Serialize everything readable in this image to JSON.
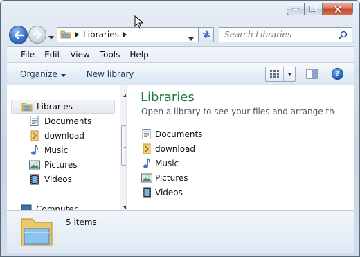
{
  "window": {
    "caption_buttons": [
      "minimize",
      "maximize",
      "close"
    ]
  },
  "navigation": {
    "address_crumbs": [
      "Libraries"
    ],
    "search_placeholder": "Search Libraries"
  },
  "menu": {
    "items": [
      "File",
      "Edit",
      "View",
      "Tools",
      "Help"
    ]
  },
  "commands": {
    "organize": "Organize",
    "new_library": "New library",
    "help_label": "?"
  },
  "nav_pane": {
    "items": [
      {
        "label": "Libraries",
        "icon": "libraries-folder-icon",
        "selected": true
      },
      {
        "label": "Documents",
        "icon": "documents-icon"
      },
      {
        "label": "download",
        "icon": "download-folder-icon"
      },
      {
        "label": "Music",
        "icon": "music-icon"
      },
      {
        "label": "Pictures",
        "icon": "pictures-icon"
      },
      {
        "label": "Videos",
        "icon": "videos-icon"
      },
      {
        "label": "Computer",
        "icon": "computer-icon"
      }
    ]
  },
  "content": {
    "title": "Libraries",
    "subtitle": "Open a library to see your files and arrange them b...",
    "items": [
      {
        "label": "Documents",
        "icon": "documents-icon"
      },
      {
        "label": "download",
        "icon": "download-folder-icon"
      },
      {
        "label": "Music",
        "icon": "music-icon"
      },
      {
        "label": "Pictures",
        "icon": "pictures-icon"
      },
      {
        "label": "Videos",
        "icon": "videos-icon"
      }
    ]
  },
  "details": {
    "count_text": "5 items"
  },
  "colors": {
    "title_green": "#1d7a3b",
    "command_text": "#1e395b"
  }
}
